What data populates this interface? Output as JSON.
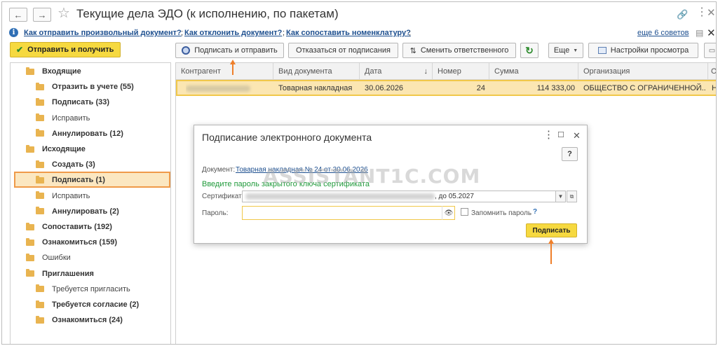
{
  "window": {
    "title": "Текущие дела ЭДО (к исполнению, по пакетам)",
    "back_icon": "←",
    "forward_icon": "→"
  },
  "help": {
    "links": [
      "Как отправить произвольный документ?",
      "Как отклонить документ?",
      "Как сопоставить номенклатуру?"
    ],
    "separator": ";",
    "more_tips": "еще 6 советов"
  },
  "left": {
    "send_receive_label": "Отправить и получить",
    "tree": [
      {
        "label": "Входящие",
        "level": 0,
        "bold": true
      },
      {
        "label": "Отразить в учете (55)",
        "level": 1,
        "bold": true
      },
      {
        "label": "Подписать (33)",
        "level": 1,
        "bold": true
      },
      {
        "label": "Исправить",
        "level": 1,
        "bold": false
      },
      {
        "label": "Аннулировать (12)",
        "level": 1,
        "bold": true
      },
      {
        "label": "Исходящие",
        "level": 0,
        "bold": true
      },
      {
        "label": "Создать (3)",
        "level": 1,
        "bold": true
      },
      {
        "label": "Подписать (1)",
        "level": 1,
        "bold": true,
        "selected": true
      },
      {
        "label": "Исправить",
        "level": 1,
        "bold": false
      },
      {
        "label": "Аннулировать (2)",
        "level": 1,
        "bold": true
      },
      {
        "label": "Сопоставить (192)",
        "level": 0,
        "bold": true
      },
      {
        "label": "Ознакомиться (159)",
        "level": 0,
        "bold": true
      },
      {
        "label": "Ошибки",
        "level": 0,
        "bold": false
      },
      {
        "label": "Приглашения",
        "level": 0,
        "bold": true
      },
      {
        "label": "Требуется пригласить",
        "level": 1,
        "bold": false
      },
      {
        "label": "Требуется согласие (2)",
        "level": 1,
        "bold": true
      },
      {
        "label": "Ознакомиться (24)",
        "level": 1,
        "bold": true
      }
    ]
  },
  "toolbar": {
    "sign_send_label": "Подписать и отправить",
    "refuse_sign_label": "Отказаться от подписания",
    "change_responsible_label": "Сменить ответственного",
    "more_label": "Еще",
    "view_settings_label": "Настройки просмотра"
  },
  "grid": {
    "columns": [
      "Контрагент",
      "Вид документа",
      "Дата",
      "Номер",
      "Сумма",
      "Организация",
      "О"
    ],
    "sort_indicator": "↓",
    "rows": [
      {
        "counterparty": "",
        "doc_type": "Товарная накладная",
        "date": "30.06.2026",
        "number": "24",
        "amount": "114 333,00",
        "organization": "ОБЩЕСТВО С ОГРАНИЧЕННОЙ...",
        "extra": "Н"
      }
    ]
  },
  "dialog": {
    "title": "Подписание электронного документа",
    "help_label": "?",
    "document_label": "Документ:",
    "document_link": "Товарная накладная № 24 от 30.06.2026",
    "hint": "Введите пароль закрытого ключа сертификата",
    "certificate_label": "Сертификат:",
    "certificate_value": ", до 05.2027",
    "password_label": "Пароль:",
    "password_value": "",
    "remember_label": "Запомнить пароль",
    "remember_help": "?",
    "sign_label": "Подписать"
  },
  "watermark": "ASSISTANT1C.COM",
  "colors": {
    "accent_yellow": "#f6d940",
    "selection_orange": "#ef9a49",
    "link_blue": "#1d4f8f",
    "hint_green": "#1f9a3a",
    "arrow_orange": "#ef7f2a"
  }
}
